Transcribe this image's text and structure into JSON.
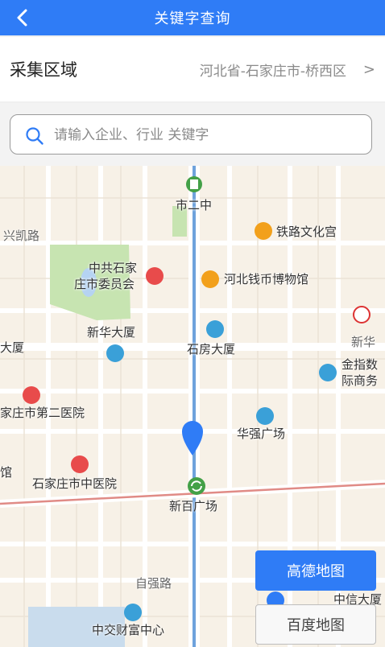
{
  "header": {
    "title": "关键字查询"
  },
  "region": {
    "label": "采集区域",
    "value": "河北省-石家庄市-桥西区",
    "chevron": ">"
  },
  "search": {
    "placeholder": "请输入企业、行业 关键字",
    "value": ""
  },
  "map": {
    "labels": {
      "shi_gong_zhong": "市二中",
      "railway_palace": "铁路文化宫",
      "xingkai_road": "兴凯路",
      "party_committee_1": "中共石家",
      "party_committee_2": "庄市委员会",
      "coin_museum": "河北钱币博物馆",
      "xinhua_building": "新华大厦",
      "shifang_building": "石房大厦",
      "left_building": "大厦",
      "xinhua_right": "新华",
      "jinzhi_1": "金指数",
      "jinzhi_2": "际商务",
      "second_hospital": "家庄市第二医院",
      "huaqiang": "华强广场",
      "left_guan": "馆",
      "tcm_hospital": "石家庄市中医院",
      "xinbai": "新百广场",
      "ziqiang_road": "自强路",
      "zhongxin": "中信大厦",
      "zhongjiao": "中交财富中心"
    }
  },
  "buttons": {
    "gaode": "高德地图",
    "baidu": "百度地图"
  }
}
